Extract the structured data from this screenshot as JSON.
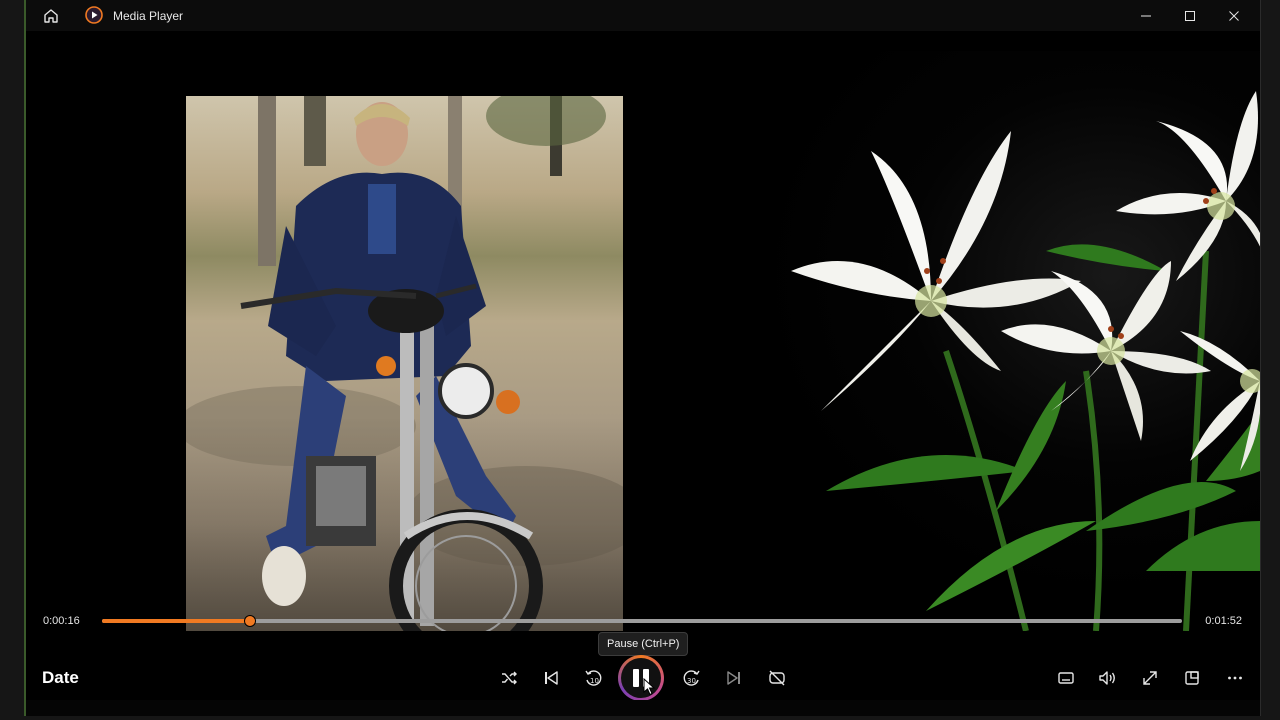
{
  "titlebar": {
    "title": "Media Player"
  },
  "icons": {
    "home": "home-icon",
    "app": "media-player-icon",
    "minimize": "minimize-icon",
    "maximize": "maximize-icon",
    "close": "close-icon"
  },
  "playback": {
    "current_time": "0:00:16",
    "total_time": "0:01:52",
    "progress_fraction": 0.137
  },
  "tooltip": {
    "text": "Pause (Ctrl+P)"
  },
  "now_playing": {
    "title": "Date"
  },
  "colors": {
    "accent": "#f07a22",
    "track": "#9d9d9d",
    "background": "#000000"
  }
}
